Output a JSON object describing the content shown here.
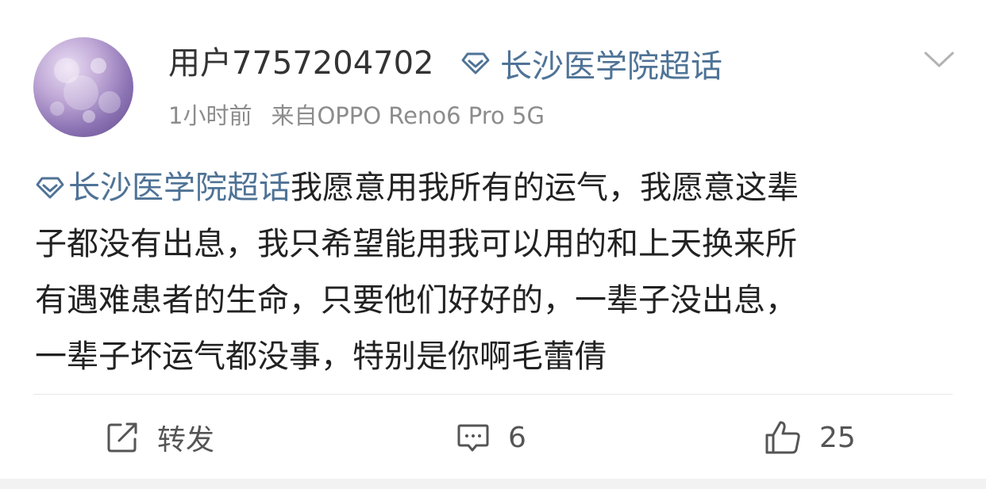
{
  "post": {
    "username": "用户7757204702",
    "topic_name": "长沙医学院超话",
    "time": "1小时前",
    "source": "来自OPPO Reno6 Pro 5G",
    "content_topic": "长沙医学院超话",
    "content_lines": [
      "我愿意用我所有的运气，我愿意这辈",
      "子都没有出息，我只希望能用我可以用的和上天换来所",
      "有遇难患者的生命，只要他们好好的，一辈子没出息，",
      "一辈子坏运气都没事，特别是你啊毛蕾倩"
    ]
  },
  "actions": {
    "repost_label": "转发",
    "comment_count": "6",
    "like_count": "25"
  },
  "icons": {
    "topic": "diamond-topic-icon",
    "menu": "chevron-down-icon",
    "repost": "repost-icon",
    "comment": "comment-icon",
    "like": "thumbs-up-icon"
  },
  "colors": {
    "topic_link": "#4f7396",
    "text": "#222222",
    "meta": "#8c8c8c"
  }
}
